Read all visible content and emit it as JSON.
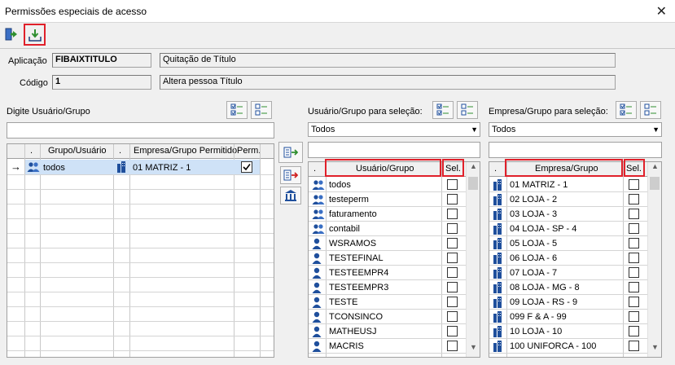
{
  "window": {
    "title": "Permissões especiais de acesso",
    "close_glyph": "✕"
  },
  "toolbar": {
    "exit_icon": "exit-door-icon",
    "export_icon": "tray-export-icon"
  },
  "form": {
    "aplicacao_label": "Aplicação",
    "aplicacao_value": "FIBAIXTITULO",
    "aplicacao_desc": "Quitação de Título",
    "codigo_label": "Código",
    "codigo_value": "1",
    "codigo_desc": "Altera pessoa Título"
  },
  "left_panel": {
    "label": "Digite Usuário/Grupo",
    "search_value": "",
    "columns": [
      ".",
      "Grupo/Usuário",
      ".",
      "Empresa/Grupo Permitido",
      "Perm."
    ],
    "rows": [
      {
        "marker": "→",
        "user": "todos",
        "empresa": "01 MATRIZ - 1",
        "perm": true
      }
    ]
  },
  "middle_buttons": [
    "add-permission-icon",
    "remove-permission-icon",
    "bank-icon"
  ],
  "user_panel": {
    "label": "Usuário/Grupo para seleção:",
    "combo_value": "Todos",
    "search_value": "",
    "columns": [
      ".",
      "Usuário/Grupo",
      "Sel."
    ],
    "items": [
      {
        "type": "group",
        "name": "todos"
      },
      {
        "type": "group",
        "name": "testeperm"
      },
      {
        "type": "group",
        "name": "faturamento"
      },
      {
        "type": "group",
        "name": "contabil"
      },
      {
        "type": "user",
        "name": "WSRAMOS"
      },
      {
        "type": "user",
        "name": "TESTEFINAL"
      },
      {
        "type": "user",
        "name": "TESTEEMPR4"
      },
      {
        "type": "user",
        "name": "TESTEEMPR3"
      },
      {
        "type": "user",
        "name": "TESTE"
      },
      {
        "type": "user",
        "name": "TCONSINCO"
      },
      {
        "type": "user",
        "name": "MATHEUSJ"
      },
      {
        "type": "user",
        "name": "MACRIS"
      }
    ]
  },
  "company_panel": {
    "label": "Empresa/Grupo para seleção:",
    "combo_value": "Todos",
    "search_value": "",
    "columns": [
      ".",
      "Empresa/Grupo",
      "Sel."
    ],
    "items": [
      "01 MATRIZ - 1",
      "02 LOJA - 2",
      "03 LOJA - 3",
      "04 LOJA - SP - 4",
      "05 LOJA - 5",
      "06 LOJA - 6",
      "07 LOJA - 7",
      "08 LOJA - MG - 8",
      "09 LOJA - RS - 9",
      "099 F & A - 99",
      "10 LOJA - 10",
      "100 UNIFORCA - 100"
    ]
  },
  "colors": {
    "highlight_red": "#e0202a",
    "selected_row": "#cfe2f7",
    "icon_blue": "#1f4f9c"
  }
}
